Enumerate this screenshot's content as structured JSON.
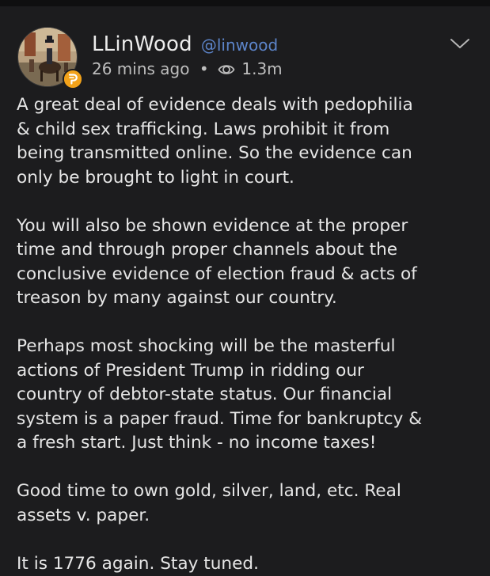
{
  "post": {
    "author": {
      "display_name": "LLinWood",
      "handle": "@linwood",
      "avatar_icon": "avatar-image",
      "badge_icon": "parler-badge-icon",
      "badge_color": "#f2a21a"
    },
    "meta": {
      "time": "26 mins ago",
      "separator": "•",
      "views_icon": "eye-icon",
      "views": "1.3m"
    },
    "menu_icon": "chevron-down-icon",
    "paragraphs": [
      "A great deal of evidence deals with pedophilia\n& child sex trafficking. Laws prohibit it from\nbeing transmitted online. So the evidence can\nonly be brought to light in court.",
      "You will also be shown evidence at the proper\ntime and through proper channels about the\nconclusive evidence of election fraud & acts of\ntreason by many against our country.",
      "Perhaps most shocking will be the masterful\nactions of President Trump in ridding our\ncountry of debtor-state status. Our financial\nsystem is a paper fraud. Time for bankruptcy &\na fresh start. Just think - no income taxes!",
      "Good time to own gold, silver, land, etc. Real\nassets v. paper.",
      "It is 1776 again. Stay tuned."
    ]
  },
  "colors": {
    "background": "#1c1c1e",
    "handle": "#5c84c9",
    "text": "#e6e6e6",
    "meta": "#bdbdbd"
  }
}
